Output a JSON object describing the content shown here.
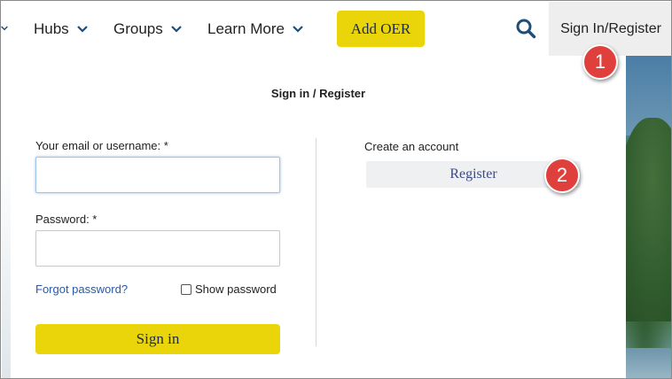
{
  "nav": {
    "items": [
      {
        "label": "Hubs"
      },
      {
        "label": "Groups"
      },
      {
        "label": "Learn More"
      }
    ],
    "add_button": "Add OER",
    "signin_label": "Sign In/Register"
  },
  "panel": {
    "title": "Sign in / Register",
    "login": {
      "email_label": "Your email or username: *",
      "email_value": "",
      "password_label": "Password: *",
      "password_value": "",
      "forgot_link": "Forgot password?",
      "show_password_label": "Show password",
      "show_password_checked": false,
      "submit_label": "Sign in"
    },
    "create": {
      "label": "Create an account",
      "register_label": "Register"
    }
  },
  "callouts": [
    "1",
    "2"
  ],
  "colors": {
    "accent_yellow": "#e9d50a",
    "nav_icon_blue": "#1f4d7a",
    "link_blue": "#2c5aa0",
    "marker_red": "#e0403b"
  },
  "icons": {
    "nav_chevron": "chevron-down-icon",
    "search": "search-icon"
  }
}
